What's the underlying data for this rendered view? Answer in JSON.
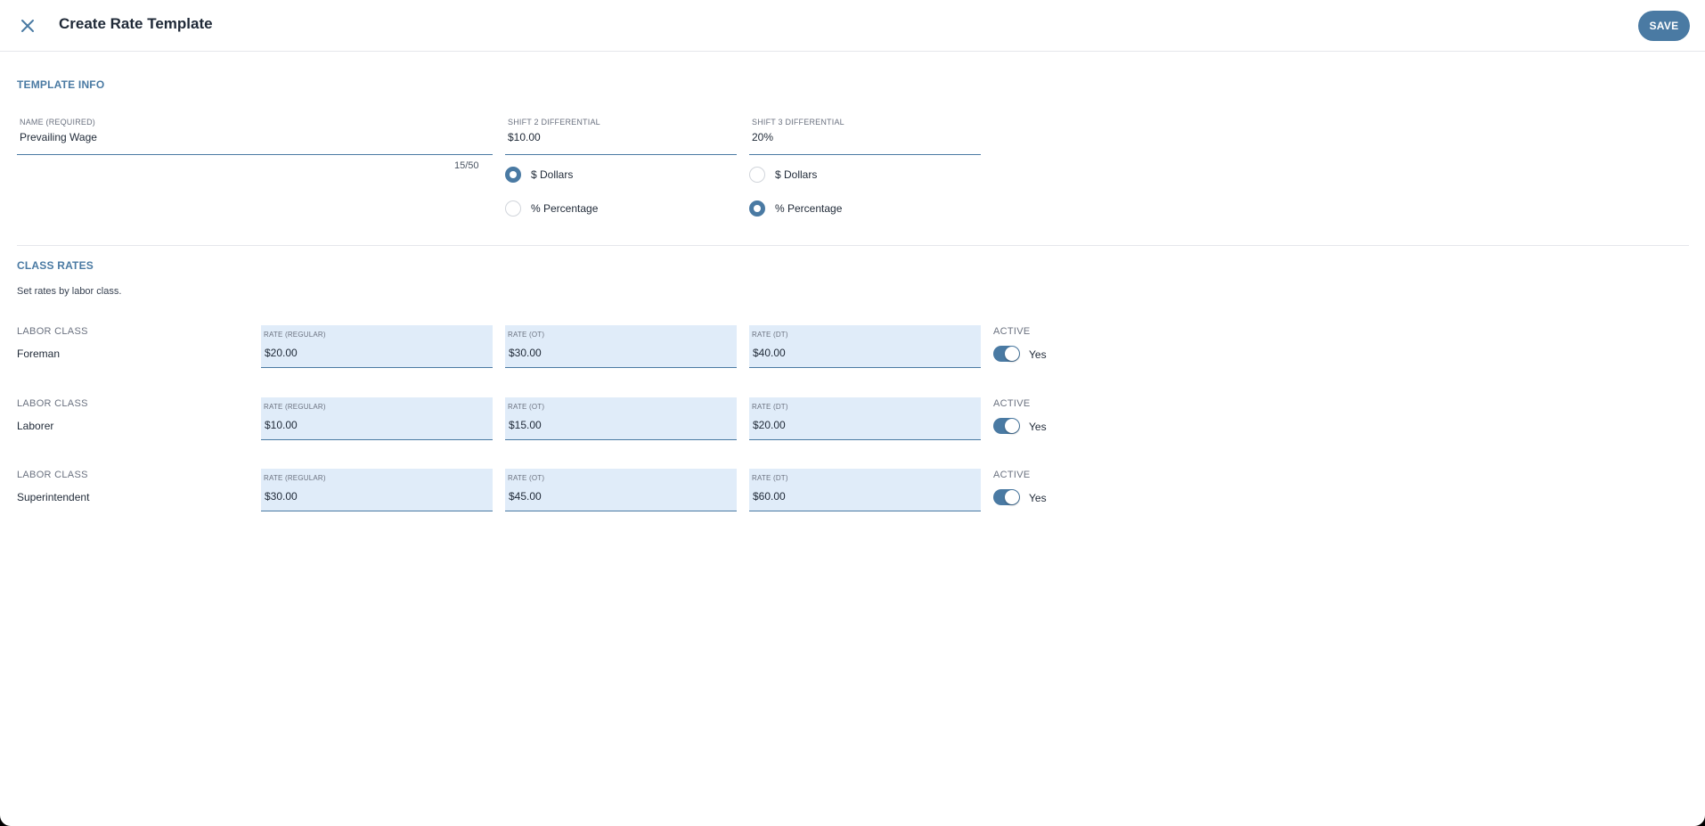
{
  "header": {
    "title": "Create Rate Template",
    "save_label": "SAVE",
    "close_icon": "close-icon"
  },
  "template_info": {
    "section_title": "TEMPLATE INFO",
    "name": {
      "label": "NAME (REQUIRED)",
      "value": "Prevailing Wage",
      "counter": "15/50"
    },
    "shift2": {
      "label": "SHIFT 2 DIFFERENTIAL",
      "value": "$10.00",
      "options": [
        {
          "label": "$ Dollars",
          "selected": true
        },
        {
          "label": "% Percentage",
          "selected": false
        }
      ]
    },
    "shift3": {
      "label": "SHIFT 3 DIFFERENTIAL",
      "value": "20%",
      "options": [
        {
          "label": "$ Dollars",
          "selected": false
        },
        {
          "label": "% Percentage",
          "selected": true
        }
      ]
    }
  },
  "class_rates": {
    "section_title": "CLASS RATES",
    "description": "Set rates by labor class.",
    "rows": [
      {
        "class_label": "LABOR CLASS",
        "class_name": "Foreman",
        "regular": {
          "label": "RATE (REGULAR)",
          "value": "$20.00"
        },
        "ot": {
          "label": "RATE (OT)",
          "value": "$30.00"
        },
        "dt": {
          "label": "RATE (DT)",
          "value": "$40.00"
        },
        "active": {
          "label": "ACTIVE",
          "text": "Yes",
          "on": true
        }
      },
      {
        "class_label": "LABOR CLASS",
        "class_name": "Laborer",
        "regular": {
          "label": "RATE (REGULAR)",
          "value": "$10.00"
        },
        "ot": {
          "label": "RATE (OT)",
          "value": "$15.00"
        },
        "dt": {
          "label": "RATE (DT)",
          "value": "$20.00"
        },
        "active": {
          "label": "ACTIVE",
          "text": "Yes",
          "on": true
        }
      },
      {
        "class_label": "LABOR CLASS",
        "class_name": "Superintendent",
        "regular": {
          "label": "RATE (REGULAR)",
          "value": "$30.00"
        },
        "ot": {
          "label": "RATE (OT)",
          "value": "$45.00"
        },
        "dt": {
          "label": "RATE (DT)",
          "value": "$60.00"
        },
        "active": {
          "label": "ACTIVE",
          "text": "Yes",
          "on": true
        }
      }
    ]
  },
  "colors": {
    "accent": "#4a7aa3",
    "input_fill": "#e0ecf9"
  }
}
